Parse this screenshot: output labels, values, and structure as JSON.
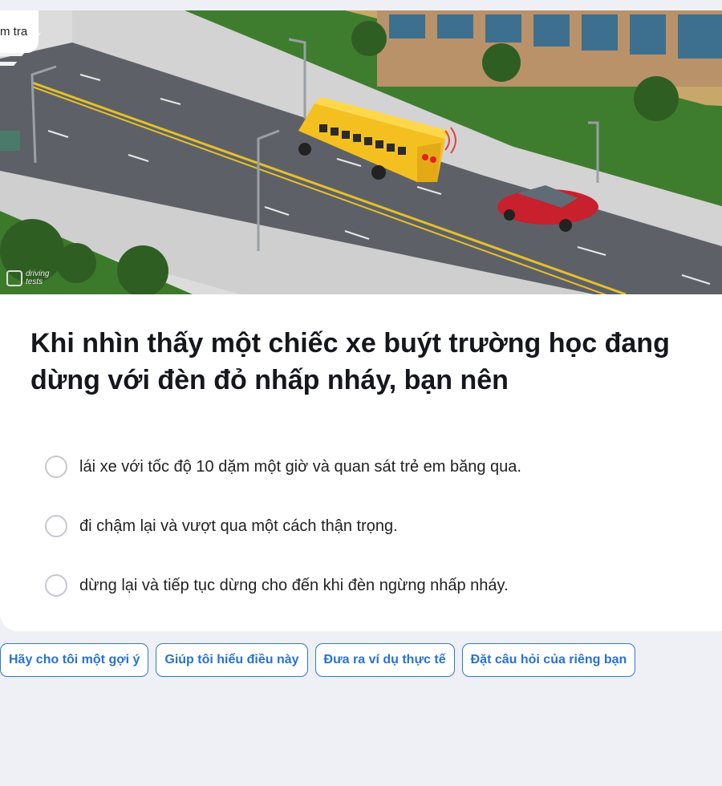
{
  "badge": {
    "label": "m tra"
  },
  "watermark": {
    "text": "driving tests",
    "icon": "driving-tests-logo-icon"
  },
  "question": {
    "text": "Khi nhìn thấy một chiếc xe buýt trường học đang dừng với đèn đỏ nhấp nháy, bạn nên"
  },
  "options": [
    {
      "label": "lái xe với tốc độ 10 dặm một giờ và quan sát trẻ em băng qua."
    },
    {
      "label": "đi chậm lại và vượt qua một cách thận trọng."
    },
    {
      "label": "dừng lại và tiếp tục dừng cho đến khi đèn ngừng nhấp nháy."
    }
  ],
  "chips": [
    {
      "label": "Hãy cho tôi một gợi ý"
    },
    {
      "label": "Giúp tôi hiểu điều này"
    },
    {
      "label": "Đưa ra ví dụ thực tế"
    },
    {
      "label": "Đặt câu hỏi của riêng bạn"
    }
  ],
  "colors": {
    "accent": "#2872d3",
    "page_background": "#eff0f5",
    "bus": "#f4c020",
    "car": "#c8202c"
  }
}
